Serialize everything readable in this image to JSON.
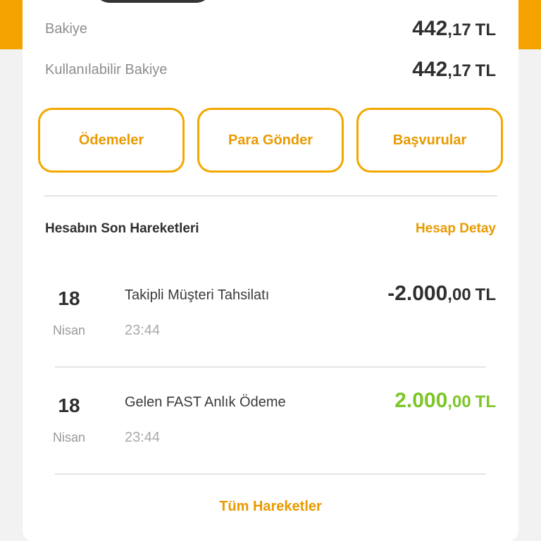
{
  "balance": {
    "label": "Bakiye",
    "int": "442",
    "dec": ",17",
    "currency": "TL"
  },
  "available_balance": {
    "label": "Kullanılabilir Bakiye",
    "int": "442",
    "dec": ",17",
    "currency": "TL"
  },
  "actions": [
    {
      "label": "Ödemeler"
    },
    {
      "label": "Para Gönder"
    },
    {
      "label": "Başvurular"
    }
  ],
  "recent": {
    "title": "Hesabın Son Hareketleri",
    "detail_link": "Hesap Detay",
    "transactions": [
      {
        "day": "18",
        "month": "Nisan",
        "description": "Takipli Müşteri Tahsilatı",
        "time": "23:44",
        "amount_int": "-2.000",
        "amount_dec": ",00",
        "currency": "TL",
        "color": "#2f2f2f"
      },
      {
        "day": "18",
        "month": "Nisan",
        "description": "Gelen FAST Anlık Ödeme",
        "time": "23:44",
        "amount_int": "2.000",
        "amount_dec": ",00",
        "currency": "TL",
        "color": "#7ec52a"
      }
    ],
    "all_link": "Tüm Hareketler"
  },
  "colors": {
    "accent": "#f3a200",
    "positive": "#7ec52a"
  }
}
